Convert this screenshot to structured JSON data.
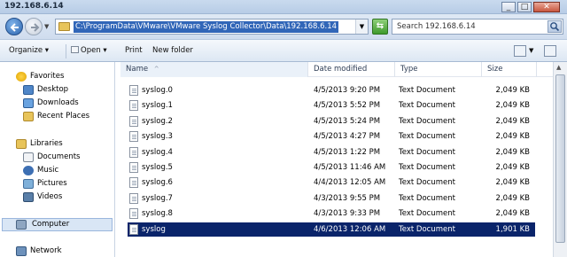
{
  "window": {
    "title": "192.168.6.14",
    "minimize": "_",
    "maximize": "□",
    "close": "✕"
  },
  "address": {
    "path": "C:\\ProgramData\\VMware\\VMware Syslog Collector\\Data\\192.168.6.14"
  },
  "search": {
    "placeholder": "Search 192.168.6.14"
  },
  "toolbar": {
    "organize": "Organize ▾",
    "open": "Open ▾",
    "print": "Print",
    "new_folder": "New folder"
  },
  "nav": {
    "favorites": "Favorites",
    "desktop": "Desktop",
    "downloads": "Downloads",
    "recent": "Recent Places",
    "libraries": "Libraries",
    "documents": "Documents",
    "music": "Music",
    "pictures": "Pictures",
    "videos": "Videos",
    "computer": "Computer",
    "network": "Network"
  },
  "columns": {
    "name": "Name",
    "date": "Date modified",
    "type": "Type",
    "size": "Size"
  },
  "files": [
    {
      "name": "syslog.0",
      "date": "4/5/2013 9:20 PM",
      "type": "Text Document",
      "size": "2,049 KB"
    },
    {
      "name": "syslog.1",
      "date": "4/5/2013 5:52 PM",
      "type": "Text Document",
      "size": "2,049 KB"
    },
    {
      "name": "syslog.2",
      "date": "4/5/2013 5:24 PM",
      "type": "Text Document",
      "size": "2,049 KB"
    },
    {
      "name": "syslog.3",
      "date": "4/5/2013 4:27 PM",
      "type": "Text Document",
      "size": "2,049 KB"
    },
    {
      "name": "syslog.4",
      "date": "4/5/2013 1:22 PM",
      "type": "Text Document",
      "size": "2,049 KB"
    },
    {
      "name": "syslog.5",
      "date": "4/5/2013 11:46 AM",
      "type": "Text Document",
      "size": "2,049 KB"
    },
    {
      "name": "syslog.6",
      "date": "4/4/2013 12:05 AM",
      "type": "Text Document",
      "size": "2,049 KB"
    },
    {
      "name": "syslog.7",
      "date": "4/3/2013 9:55 PM",
      "type": "Text Document",
      "size": "2,049 KB"
    },
    {
      "name": "syslog.8",
      "date": "4/3/2013 9:33 PM",
      "type": "Text Document",
      "size": "2,049 KB"
    },
    {
      "name": "syslog",
      "date": "4/6/2013 12:06 AM",
      "type": "Text Document",
      "size": "1,901 KB"
    }
  ],
  "colors": {
    "selection": "#0a246a",
    "address_highlight": "#3166b8"
  }
}
